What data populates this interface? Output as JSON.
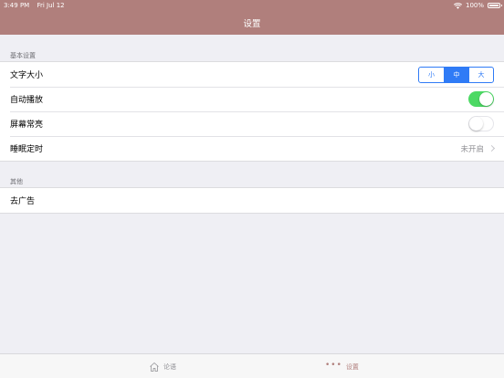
{
  "status": {
    "time": "3:49 PM",
    "date": "Fri Jul 12",
    "battery": "100%",
    "wifi_icon": "wifi-icon",
    "battery_icon": "battery-icon"
  },
  "nav": {
    "title": "设置"
  },
  "sections": {
    "basic": {
      "header": "基本设置",
      "font_size": {
        "label": "文字大小",
        "options": [
          "小",
          "中",
          "大"
        ],
        "selected": "中"
      },
      "autoplay": {
        "label": "自动播放",
        "on": true
      },
      "screen_on": {
        "label": "屏幕常亮",
        "on": false
      },
      "sleep_timer": {
        "label": "睡眠定时",
        "value": "未开启"
      }
    },
    "other": {
      "header": "其他",
      "remove_ads": {
        "label": "去广告"
      }
    }
  },
  "tabbar": {
    "forum": {
      "label": "论语",
      "icon": "home-icon"
    },
    "settings": {
      "label": "设置",
      "icon": "more-dots-icon"
    }
  },
  "colors": {
    "nav_bar": "#b07f7c",
    "accent_blue": "#2f7bf6",
    "toggle_on": "#4cd964",
    "background": "#efeff4"
  }
}
